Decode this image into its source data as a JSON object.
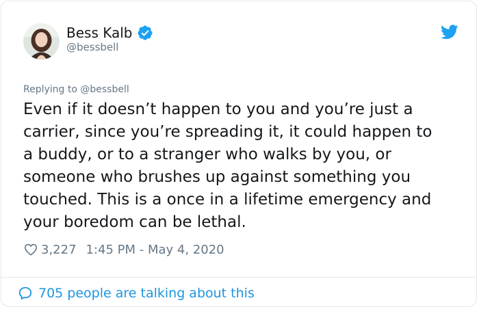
{
  "author": {
    "name": "Bess Kalb",
    "handle": "@bessbell",
    "verified": true
  },
  "reply_context": "Replying to @bessbell",
  "tweet": {
    "text": "Even if it doesn’t happen to you and you’re just a\ncarrier, since you’re spreading it, it could happen to\na buddy, or to a stranger who walks by you, or\nsomeone who brushes up against something you\ntouched. This is a once in a lifetime emergency and\nyour boredom can be lethal."
  },
  "meta": {
    "likes": "3,227",
    "timestamp": "1:45 PM - May 4, 2020"
  },
  "footer": {
    "conversation_label": "705 people are talking about this"
  },
  "icons": {
    "verified": "verified-badge-icon",
    "logo": "twitter-bird-icon",
    "like": "heart-icon",
    "conversation": "speech-bubble-icon"
  },
  "colors": {
    "accent": "#1da1f2",
    "link": "#1b95e0",
    "secondary_text": "#657786",
    "primary_text": "#14171a",
    "border": "#e1e8ed"
  }
}
